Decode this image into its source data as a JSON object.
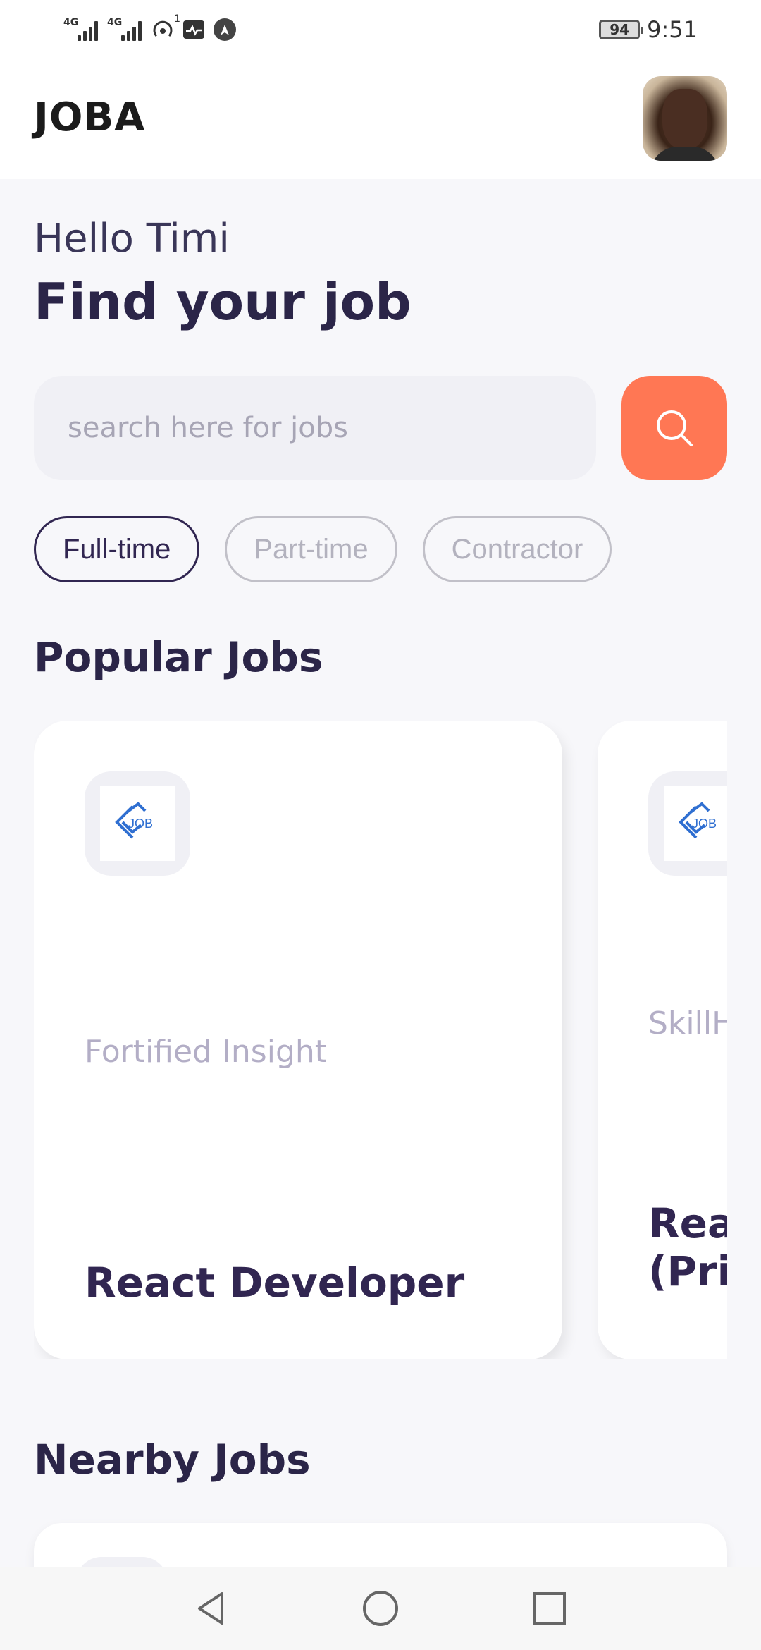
{
  "status_bar": {
    "signal1_label": "4G",
    "signal2_label": "4G",
    "hotspot_count": "1",
    "battery": "94",
    "time": "9:51"
  },
  "header": {
    "app_title": "JOBA"
  },
  "greeting": {
    "hello": "Hello Timi",
    "headline": "Find your job"
  },
  "search": {
    "placeholder": "search here for jobs",
    "value": ""
  },
  "job_types": [
    {
      "label": "Full-time",
      "active": true
    },
    {
      "label": "Part-time",
      "active": false
    },
    {
      "label": "Contractor",
      "active": false
    }
  ],
  "popular": {
    "title": "Popular Jobs",
    "cards": [
      {
        "company": "Fortified Insight",
        "title": "React Developer",
        "logo_text": "JOB"
      },
      {
        "company": "SkillH",
        "title_line1": "Reac",
        "title_line2": "(Prir",
        "logo_text": "JOB"
      }
    ]
  },
  "nearby": {
    "title": "Nearby Jobs"
  },
  "colors": {
    "accent": "#FF7754",
    "primary": "#312651",
    "background": "#F7F7FA",
    "logo_blue": "#2F6FD1"
  },
  "icons": [
    "search-icon",
    "back-icon",
    "home-icon",
    "recents-icon",
    "hotspot-icon",
    "activity-icon",
    "nav-app-icon"
  ]
}
